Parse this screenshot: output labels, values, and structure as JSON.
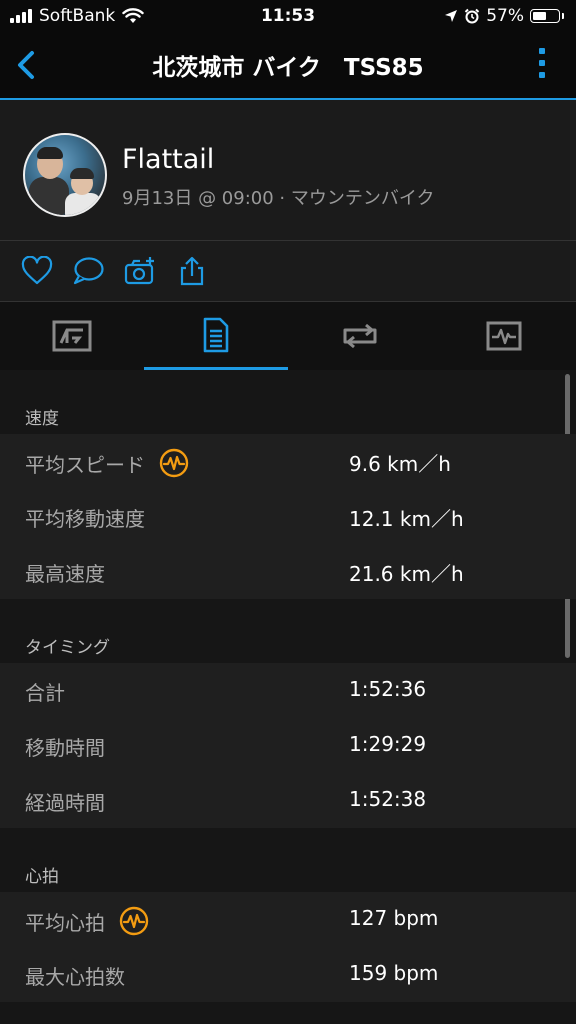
{
  "status_bar": {
    "carrier": "SoftBank",
    "time": "11:53",
    "battery_percent": "57%",
    "battery_level": 0.57
  },
  "nav": {
    "title": "北茨城市 バイク　TSS85"
  },
  "profile": {
    "name": "Flattail",
    "meta": "9月13日 @ 09:00 · マウンテンバイク"
  },
  "icons": {
    "back": "chevron-left-icon",
    "menu": "more-vertical-icon",
    "like": "heart-icon",
    "comment": "comment-icon",
    "camera": "camera-add-icon",
    "share": "share-icon",
    "tab_map": "map-chart-icon",
    "tab_stats": "document-list-icon",
    "tab_laps": "repeat-icon",
    "tab_charts": "pulse-graph-icon",
    "badge": "heart-rate-badge-icon"
  },
  "colors": {
    "accent": "#1e9be4",
    "badge": "#f39c12"
  },
  "sections": [
    {
      "header": "速度",
      "rows": [
        {
          "label": "平均スピード",
          "value": "9.6 km／h",
          "badge": true
        },
        {
          "label": "平均移動速度",
          "value": "12.1 km／h",
          "badge": false
        },
        {
          "label": "最高速度",
          "value": "21.6 km／h",
          "badge": false
        }
      ]
    },
    {
      "header": "タイミング",
      "rows": [
        {
          "label": "合計",
          "value": "1:52:36",
          "badge": false
        },
        {
          "label": "移動時間",
          "value": "1:29:29",
          "badge": false
        },
        {
          "label": "経過時間",
          "value": "1:52:38",
          "badge": false
        }
      ]
    },
    {
      "header": "心拍",
      "rows": [
        {
          "label": "平均心拍",
          "value": "127 bpm",
          "badge": true
        },
        {
          "label": "最大心拍数",
          "value": "159 bpm",
          "badge": false
        }
      ]
    }
  ]
}
